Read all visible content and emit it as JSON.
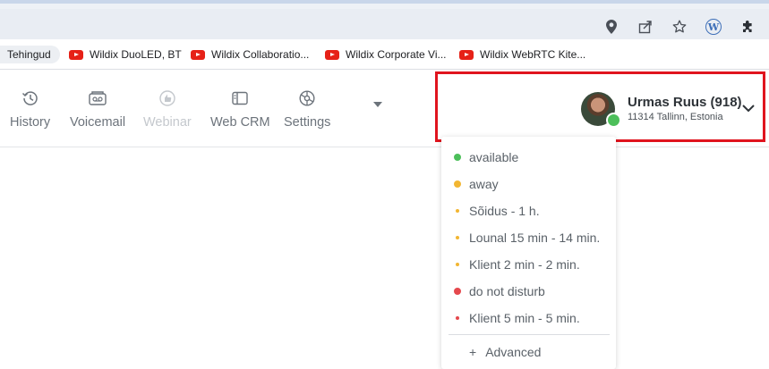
{
  "browser": {
    "bookmarks": [
      {
        "label": "Tehingud"
      },
      {
        "label": "Wildix DuoLED, BT"
      },
      {
        "label": "Wildix Collaboratio..."
      },
      {
        "label": "Wildix Corporate Vi..."
      },
      {
        "label": "Wildix WebRTC Kite..."
      }
    ],
    "icons": [
      "location-icon",
      "share-icon",
      "star-icon",
      "wordpress-extension-icon",
      "extensions-puzzle-icon"
    ]
  },
  "toolbar": {
    "items": [
      {
        "label": "History",
        "icon": "history-icon",
        "enabled": true
      },
      {
        "label": "Voicemail",
        "icon": "voicemail-icon",
        "enabled": true
      },
      {
        "label": "Webinar",
        "icon": "webinar-icon",
        "enabled": false
      },
      {
        "label": "Web CRM",
        "icon": "web-crm-icon",
        "enabled": true
      },
      {
        "label": "Settings",
        "icon": "settings-icon",
        "enabled": true
      }
    ],
    "more_icon": "caret-down-icon"
  },
  "user": {
    "name": "Urmas Ruus (918)",
    "location": "11314 Tallinn, Estonia",
    "presence_color": "#4cbf5a",
    "highlight_color": "#e0141e"
  },
  "status_menu": {
    "items": [
      {
        "label": "available",
        "color": "#4cbf5a",
        "dot": "big"
      },
      {
        "label": "away",
        "color": "#f2b632",
        "dot": "big"
      },
      {
        "label": "Sõidus - 1 h.",
        "color": "#f2b632",
        "dot": "small"
      },
      {
        "label": "Lounal 15 min - 14 min.",
        "color": "#f2b632",
        "dot": "small"
      },
      {
        "label": "Klient 2 min - 2 min.",
        "color": "#f2b632",
        "dot": "small"
      },
      {
        "label": "do not disturb",
        "color": "#e5484d",
        "dot": "big"
      },
      {
        "label": "Klient 5 min - 5 min.",
        "color": "#e5484d",
        "dot": "small"
      }
    ],
    "advanced_prefix": "+",
    "advanced_label": "Advanced"
  }
}
